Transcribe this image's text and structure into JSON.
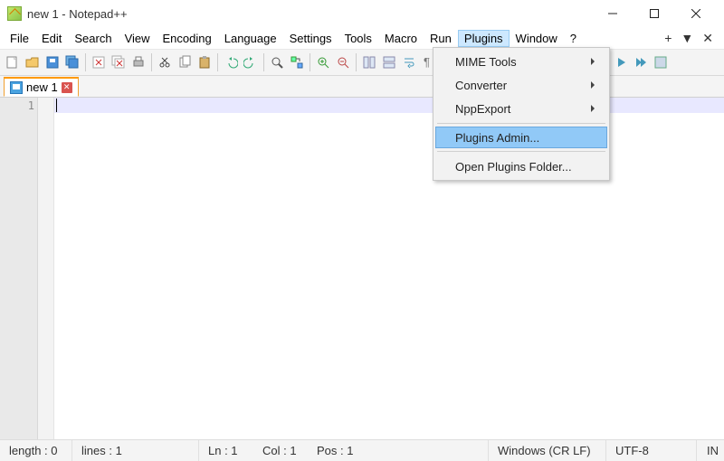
{
  "window": {
    "title": "new 1 - Notepad++"
  },
  "menubar": {
    "items": [
      "File",
      "Edit",
      "Search",
      "View",
      "Encoding",
      "Language",
      "Settings",
      "Tools",
      "Macro",
      "Run",
      "Plugins",
      "Window",
      "?"
    ],
    "active_index": 10
  },
  "tab": {
    "label": "new 1"
  },
  "editor": {
    "line_number": "1"
  },
  "dropdown": {
    "items": [
      {
        "label": "MIME Tools",
        "submenu": true
      },
      {
        "label": "Converter",
        "submenu": true
      },
      {
        "label": "NppExport",
        "submenu": true
      }
    ],
    "highlighted": {
      "label": "Plugins Admin..."
    },
    "last": {
      "label": "Open Plugins Folder..."
    }
  },
  "status": {
    "length": "length : 0",
    "lines": "lines : 1",
    "ln": "Ln : 1",
    "col": "Col : 1",
    "pos": "Pos : 1",
    "eol": "Windows (CR LF)",
    "encoding": "UTF-8",
    "mode": "IN"
  },
  "right_menu": {
    "plus": "+",
    "tri": "▼",
    "x": "✕"
  }
}
